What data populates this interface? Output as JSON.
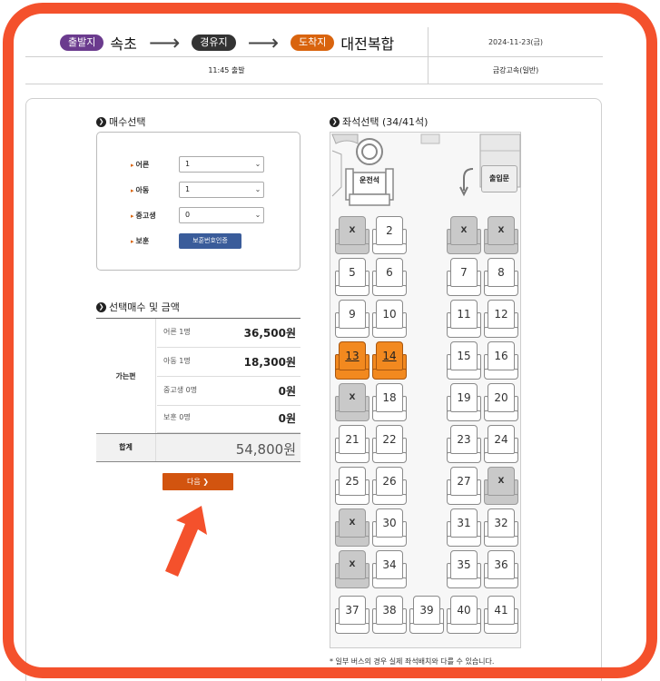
{
  "route": {
    "departure_tag": "출발지",
    "departure": "속초",
    "via_tag": "경유지",
    "arrival_tag": "도착지",
    "arrival": "대전복합",
    "arrow": "⟶",
    "date": "2024-11-23(금)",
    "time": "11:45 출발",
    "grade": "금강고속(일반)"
  },
  "count_section": {
    "title": "매수선택",
    "rows": [
      {
        "label": "어른",
        "value": "1"
      },
      {
        "label": "아동",
        "value": "1"
      },
      {
        "label": "중고생",
        "value": "0"
      }
    ],
    "veteran_label": "보훈",
    "veteran_button": "보훈번호인증"
  },
  "summary": {
    "title": "선택매수 및 금액",
    "group_label": "가는편",
    "rows": [
      {
        "label": "어른 1명",
        "value": "36,500원"
      },
      {
        "label": "아동 1명",
        "value": "18,300원"
      },
      {
        "label": "중고생 0명",
        "value": "0원"
      },
      {
        "label": "보훈 0명",
        "value": "0원"
      }
    ],
    "total_label": "합계",
    "total_value": "54,800원"
  },
  "next_button": "다음 ❯",
  "seat_section": {
    "title": "좌석선택 (34/41석)",
    "driver_label": "운전석",
    "door_label": "출입문",
    "taken_mark": "X",
    "seats": [
      {
        "label": "X",
        "state": "taken"
      },
      {
        "label": "2",
        "state": "free"
      },
      {
        "label": "X",
        "state": "taken"
      },
      {
        "label": "X",
        "state": "taken"
      },
      {
        "label": "5",
        "state": "free"
      },
      {
        "label": "6",
        "state": "free"
      },
      {
        "label": "7",
        "state": "free"
      },
      {
        "label": "8",
        "state": "free"
      },
      {
        "label": "9",
        "state": "free"
      },
      {
        "label": "10",
        "state": "free"
      },
      {
        "label": "11",
        "state": "free"
      },
      {
        "label": "12",
        "state": "free"
      },
      {
        "label": "13",
        "state": "selected"
      },
      {
        "label": "14",
        "state": "selected"
      },
      {
        "label": "15",
        "state": "free"
      },
      {
        "label": "16",
        "state": "free"
      },
      {
        "label": "X",
        "state": "taken"
      },
      {
        "label": "18",
        "state": "free"
      },
      {
        "label": "19",
        "state": "free"
      },
      {
        "label": "20",
        "state": "free"
      },
      {
        "label": "21",
        "state": "free"
      },
      {
        "label": "22",
        "state": "free"
      },
      {
        "label": "23",
        "state": "free"
      },
      {
        "label": "24",
        "state": "free"
      },
      {
        "label": "25",
        "state": "free"
      },
      {
        "label": "26",
        "state": "free"
      },
      {
        "label": "27",
        "state": "free"
      },
      {
        "label": "X",
        "state": "taken"
      },
      {
        "label": "X",
        "state": "taken"
      },
      {
        "label": "30",
        "state": "free"
      },
      {
        "label": "31",
        "state": "free"
      },
      {
        "label": "32",
        "state": "free"
      },
      {
        "label": "X",
        "state": "taken"
      },
      {
        "label": "34",
        "state": "free"
      },
      {
        "label": "35",
        "state": "free"
      },
      {
        "label": "36",
        "state": "free"
      },
      {
        "label": "37",
        "state": "free"
      },
      {
        "label": "38",
        "state": "free"
      },
      {
        "label": "39",
        "state": "free"
      },
      {
        "label": "40",
        "state": "free"
      },
      {
        "label": "41",
        "state": "free"
      }
    ],
    "note": "* 일부 버스의 경우 실제 좌석배치와 다를 수 있습니다."
  },
  "colors": {
    "frame": "#f4512c",
    "selected_seat": "#f2891f",
    "taken_seat": "#c9c9c9",
    "next_button": "#d2540f",
    "cert_button": "#3a5c9a",
    "departure_pill": "#6b3b8e",
    "arrival_pill": "#d9640e"
  }
}
